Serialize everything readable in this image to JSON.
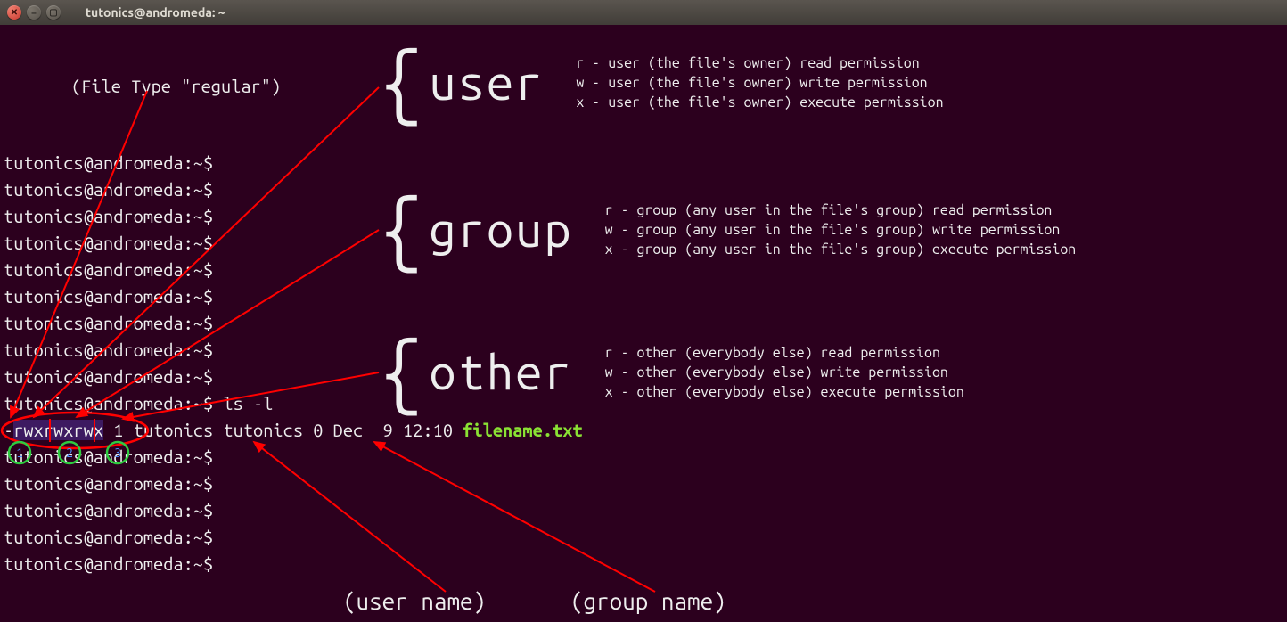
{
  "window": {
    "title": "tutonics@andromeda: ~"
  },
  "terminal": {
    "prompt": "tutonics@andromeda:~$",
    "command": "ls -l",
    "ls": {
      "dash": "-",
      "p1": "rwx",
      "p2": "rwx",
      "p3": "rwx",
      "rest": " 1 tutonics tutonics 0 Dec  9 12:10 ",
      "filename": "filename.txt"
    }
  },
  "annotation": {
    "filetype": "(File Type \"regular\")",
    "sections": {
      "user": {
        "title": "user",
        "r": "r -  user (the file's owner) read permission",
        "w": "w -  user (the file's owner) write permission",
        "x": "x -  user (the file's owner) execute permission"
      },
      "group": {
        "title": "group",
        "r": "r -  group (any user in the file's group) read permission",
        "w": "w -  group (any user in the file's group) write permission",
        "x": "x -  group (any user in the file's group) execute permission"
      },
      "other": {
        "title": "other",
        "r": "r -  other (everybody else) read permission",
        "w": "w -  other (everybody else) write permission",
        "x": "x -  other (everybody else) execute permission"
      }
    },
    "username": "(user name)",
    "groupname": "(group name)",
    "circles": {
      "n1": "1",
      "n2": "2",
      "n3": "3"
    }
  }
}
